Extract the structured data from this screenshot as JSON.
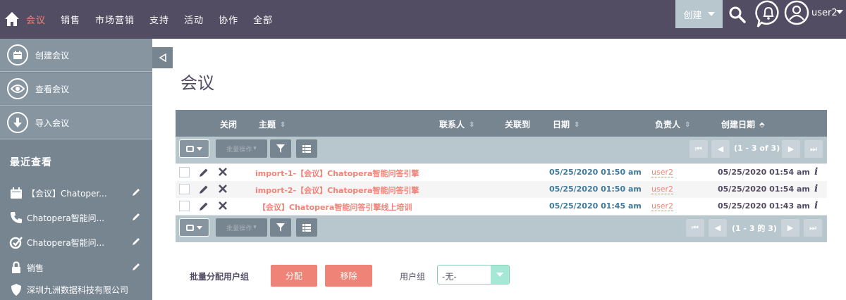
{
  "nav": {
    "items": [
      "会议",
      "销售",
      "市场营销",
      "支持",
      "活动",
      "协作",
      "全部"
    ],
    "create_label": "创建",
    "user_name": "user2"
  },
  "sidebar": {
    "actions": [
      {
        "label": "创建会议",
        "icon": "calendar-icon"
      },
      {
        "label": "查看会议",
        "icon": "eye-icon"
      },
      {
        "label": "导入会议",
        "icon": "download-icon"
      }
    ],
    "recent_title": "最近查看",
    "recent": [
      {
        "label": "【会议】Chatoper...",
        "icon": "calendar-icon"
      },
      {
        "label": "Chatopera智能问...",
        "icon": "phone-icon"
      },
      {
        "label": "Chatopera智能问...",
        "icon": "task-check-icon"
      },
      {
        "label": "销售",
        "icon": "lock-icon"
      },
      {
        "label": "深圳九洲数据科技有限公司",
        "icon": "shield-icon"
      }
    ]
  },
  "page": {
    "title": "会议"
  },
  "list": {
    "columns": {
      "close": "关闭",
      "subject": "主题",
      "contact": "联系人",
      "related": "关联到",
      "date": "日期",
      "owner": "负责人",
      "created": "创建日期"
    },
    "bulk_action": "批量操作",
    "pagination_top": "(1 - 3 of 3)",
    "pagination_bottom": "(1 - 3 的 3)",
    "rows": [
      {
        "subject": "import-1-【会议】Chatopera智能问答引擎",
        "date": "05/25/2020 01:50 am",
        "owner": "user2",
        "created": "05/25/2020 01:54 am"
      },
      {
        "subject": "import-2-【会议】Chatopera智能问答引擎",
        "date": "05/25/2020 01:50 am",
        "owner": "user2",
        "created": "05/25/2020 01:54 am"
      },
      {
        "subject": "【会议】Chatopera智能问答引擎线上培训",
        "date": "05/25/2020 01:45 am",
        "owner": "user2",
        "created": "05/25/2020 01:43 am"
      }
    ],
    "info_glyph": "i"
  },
  "mass_assign": {
    "label": "批量分配用户组",
    "assign_button": "分配",
    "remove_button": "移除",
    "group_label": "用户组",
    "group_value": "-无-"
  },
  "colors": {
    "navbar": "#534d64",
    "accent": "#f08377",
    "sidebar": "#778591",
    "date_blue": "#3f7a9c",
    "select_accent": "#a5e8d6"
  }
}
